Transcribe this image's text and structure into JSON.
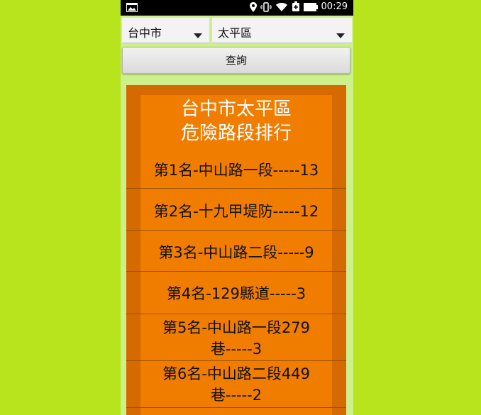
{
  "status_bar": {
    "time": "00:29"
  },
  "city_select": {
    "value": "台中市"
  },
  "district_select": {
    "value": "太平區"
  },
  "query_button": {
    "label": "查詢"
  },
  "ranking": {
    "title_line1": "台中市太平區",
    "title_line2": "危險路段排行",
    "items": [
      {
        "line1": "第1名-中山路一段-----13",
        "line2": ""
      },
      {
        "line1": "第2名-十九甲堤防-----12",
        "line2": ""
      },
      {
        "line1": "第3名-中山路二段-----9",
        "line2": ""
      },
      {
        "line1": "第4名-129縣道-----3",
        "line2": ""
      },
      {
        "line1": "第5名-中山路一段279",
        "line2": "巷-----3"
      },
      {
        "line1": "第6名-中山路二段449",
        "line2": "巷-----2"
      }
    ]
  }
}
